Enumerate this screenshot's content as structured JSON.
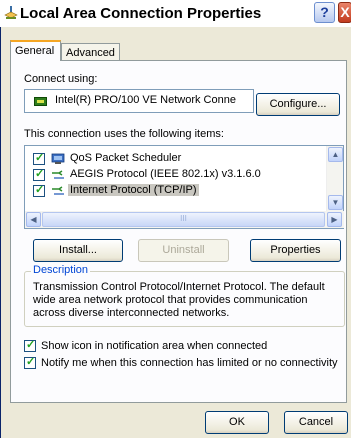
{
  "window": {
    "title": "Local Area Connection Properties",
    "help_label": "?",
    "close_label": "X"
  },
  "tabs": [
    {
      "label": "General",
      "selected": true
    },
    {
      "label": "Advanced",
      "selected": false
    }
  ],
  "connect": {
    "label": "Connect using:",
    "adapter": "Intel(R) PRO/100 VE Network Conne",
    "configure_label": "Configure..."
  },
  "items": {
    "label": "This connection uses the following items:",
    "list": [
      {
        "label": "QoS Packet Scheduler",
        "checked": true,
        "icon": "qos-icon"
      },
      {
        "label": "AEGIS Protocol (IEEE 802.1x) v3.1.6.0",
        "checked": true,
        "icon": "protocol-icon"
      },
      {
        "label": "Internet Protocol (TCP/IP)",
        "checked": true,
        "icon": "protocol-icon",
        "selected": true
      }
    ],
    "hscroll_grip": "III"
  },
  "actions": {
    "install": "Install...",
    "uninstall": "Uninstall",
    "properties": "Properties"
  },
  "description": {
    "title": "Description",
    "text": "Transmission Control Protocol/Internet Protocol. The default wide area network protocol that provides communication across diverse interconnected networks."
  },
  "options": {
    "show_icon": "Show icon in notification area when connected",
    "notify": "Notify me when this connection has limited or no connectivity"
  },
  "footer": {
    "ok": "OK",
    "cancel": "Cancel"
  }
}
